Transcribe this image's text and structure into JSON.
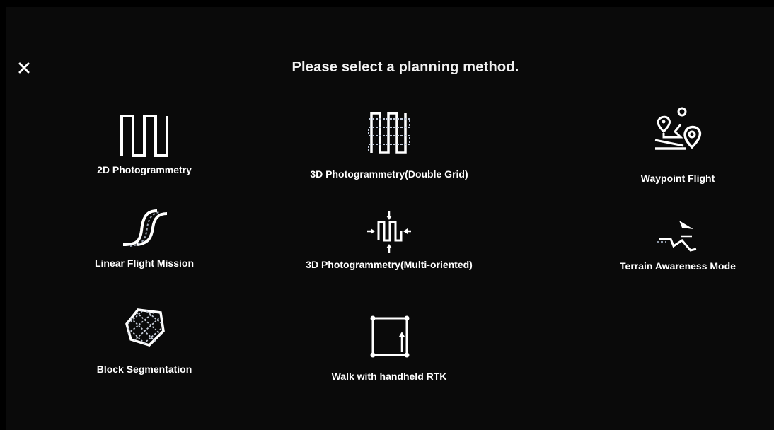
{
  "dialog": {
    "title": "Please select a planning method.",
    "close_icon": "close-icon"
  },
  "options": [
    {
      "label": "2D Photogrammetry",
      "icon": "2d-photogrammetry-icon"
    },
    {
      "label": "3D Photogrammetry(Double Grid)",
      "icon": "double-grid-icon"
    },
    {
      "label": "Waypoint Flight",
      "icon": "waypoint-icon"
    },
    {
      "label": "Linear Flight Mission",
      "icon": "linear-flight-icon"
    },
    {
      "label": "3D Photogrammetry(Multi-oriented)",
      "icon": "multi-oriented-icon"
    },
    {
      "label": "Terrain Awareness Mode",
      "icon": "terrain-awareness-icon"
    },
    {
      "label": "Block Segmentation",
      "icon": "block-segmentation-icon"
    },
    {
      "label": "Walk with handheld RTK",
      "icon": "handheld-rtk-icon"
    }
  ],
  "colors": {
    "background": "#000000",
    "text": "#ffffff",
    "title_text": "#f2f2f2"
  }
}
